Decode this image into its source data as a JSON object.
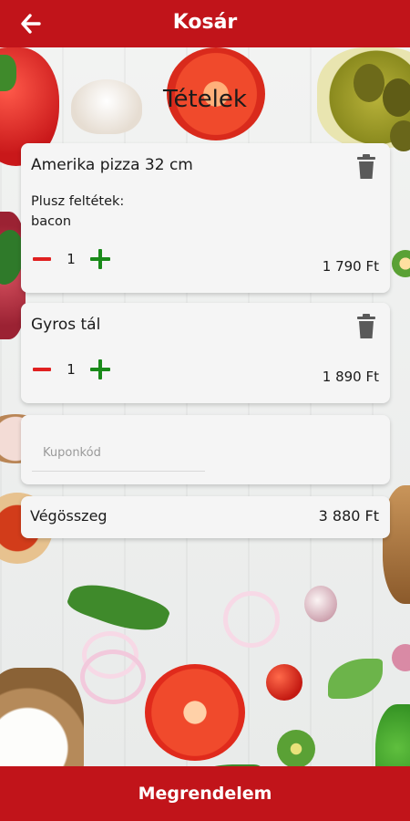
{
  "header": {
    "title": "Kosár",
    "back_icon": "arrow-left-icon"
  },
  "section_title": "Tételek",
  "items": [
    {
      "name": "Amerika pizza 32 cm",
      "extras_label": "Plusz feltétek:",
      "extras_value": "bacon",
      "quantity": "1",
      "price": "1 790 Ft"
    },
    {
      "name": "Gyros tál",
      "quantity": "1",
      "price": "1 890 Ft"
    }
  ],
  "coupon": {
    "placeholder": "Kuponkód",
    "value": ""
  },
  "total": {
    "label": "Végösszeg",
    "value": "3 880 Ft"
  },
  "footer": {
    "button_label": "Megrendelem"
  },
  "colors": {
    "brand": "#c1141a",
    "minus": "#e02020",
    "plus": "#1a8a1a",
    "trash": "#5a5a5a"
  }
}
